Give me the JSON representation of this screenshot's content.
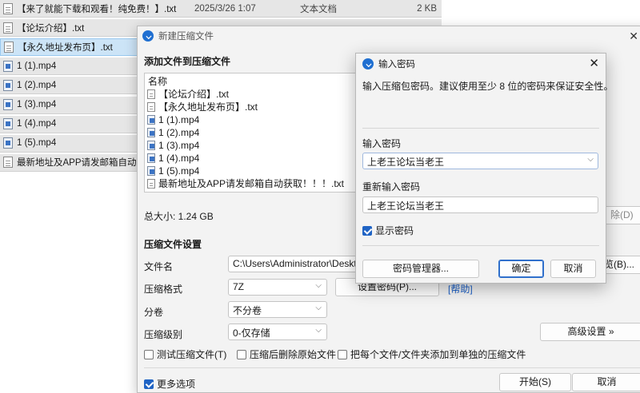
{
  "file_list": {
    "rows": [
      {
        "icon": "txt-file-icon",
        "name": "【来了就能下载和观看！纯免费！】.txt",
        "date": "2025/3/26 1:07",
        "type": "文本文档",
        "size": "2 KB",
        "selected": false
      },
      {
        "icon": "txt-file-icon",
        "name": "【论坛介绍】.txt",
        "date": "",
        "type": "",
        "size": "",
        "selected": false
      },
      {
        "icon": "txt-file-icon",
        "name": "【永久地址发布页】.txt",
        "date": "",
        "type": "",
        "size": "",
        "selected": true
      },
      {
        "icon": "mp4-file-icon",
        "name": "1 (1).mp4",
        "date": "",
        "type": "",
        "size": "",
        "selected": false
      },
      {
        "icon": "mp4-file-icon",
        "name": "1 (2).mp4",
        "date": "",
        "type": "",
        "size": "",
        "selected": false
      },
      {
        "icon": "mp4-file-icon",
        "name": "1 (3).mp4",
        "date": "",
        "type": "",
        "size": "",
        "selected": false
      },
      {
        "icon": "mp4-file-icon",
        "name": "1 (4).mp4",
        "date": "",
        "type": "",
        "size": "",
        "selected": false
      },
      {
        "icon": "mp4-file-icon",
        "name": "1 (5).mp4",
        "date": "",
        "type": "",
        "size": "",
        "selected": false
      },
      {
        "icon": "txt-file-icon",
        "name": "最新地址及APP请发邮箱自动获取！",
        "date": "",
        "type": "",
        "size": "",
        "selected": false
      }
    ]
  },
  "main_dialog": {
    "title": "新建压缩文件",
    "add_files_title": "添加文件到压缩文件",
    "list_header": "名称",
    "files": [
      {
        "icon": "txt-file-icon",
        "name": "【论坛介绍】.txt"
      },
      {
        "icon": "txt-file-icon",
        "name": "【永久地址发布页】.txt"
      },
      {
        "icon": "mp4-file-icon",
        "name": "1 (1).mp4"
      },
      {
        "icon": "mp4-file-icon",
        "name": "1 (2).mp4"
      },
      {
        "icon": "mp4-file-icon",
        "name": "1 (3).mp4"
      },
      {
        "icon": "mp4-file-icon",
        "name": "1 (4).mp4"
      },
      {
        "icon": "mp4-file-icon",
        "name": "1 (5).mp4"
      },
      {
        "icon": "txt-file-icon",
        "name": "最新地址及APP请发邮箱自动获取！！！.txt"
      }
    ],
    "total_size": "总大小: 1.24 GB",
    "remove_button_partial": "除(D)",
    "settings_title": "压缩文件设置",
    "filename_label": "文件名",
    "filename_value": "C:\\Users\\Administrator\\Desktop",
    "browse_button_partial": "览(B)...",
    "format_label": "压缩格式",
    "format_value": "7Z",
    "set_password_button": "设置密码(P)...",
    "help_link": "[帮助]",
    "split_label": "分卷",
    "split_value": "不分卷",
    "level_label": "压缩级别",
    "level_value": "0-仅存储",
    "advanced_button": "高级设置 »",
    "test_checkbox": "测试压缩文件(T)",
    "test_checked": false,
    "delete_checkbox": "压缩后删除原始文件",
    "delete_checked": false,
    "separate_checkbox": "把每个文件/文件夹添加到单独的压缩文件",
    "separate_checked": false,
    "more_options": "更多选项",
    "more_checked": true,
    "start_button": "开始(S)",
    "cancel_button": "取消"
  },
  "password_dialog": {
    "title": "输入密码",
    "description": "输入压缩包密码。建议使用至少 8 位的密码来保证安全性。",
    "password_label": "输入密码",
    "password_value": "上老王论坛当老王",
    "confirm_label": "重新输入密码",
    "confirm_value": "上老王论坛当老王",
    "show_password_label": "显示密码",
    "show_password_checked": true,
    "manager_button": "密码管理器...",
    "ok_button": "确定",
    "cancel_button": "取消"
  },
  "colors": {
    "accent": "#1f63c4",
    "selected_row": "#cce4f7",
    "row_bg": "#e6e6e6",
    "dialog_bg": "#f3f3f3"
  }
}
